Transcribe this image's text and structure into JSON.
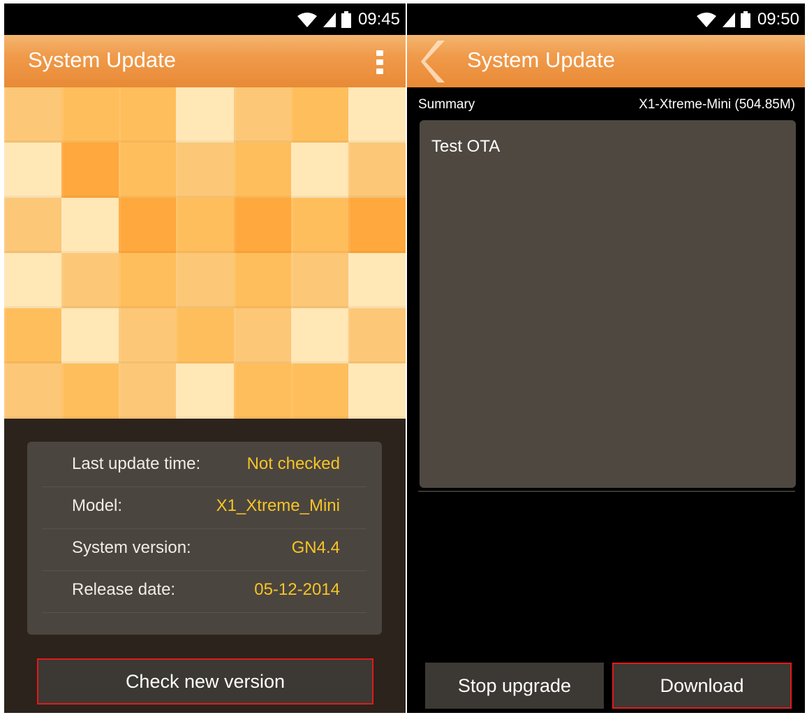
{
  "left": {
    "status": {
      "time": "09:45"
    },
    "title": "System Update",
    "info": [
      {
        "label": "Last update time:",
        "value": "Not checked"
      },
      {
        "label": "Model:",
        "value": "X1_Xtreme_Mini"
      },
      {
        "label": "System version:",
        "value": "GN4.4"
      },
      {
        "label": "Release date:",
        "value": "05-12-2014"
      }
    ],
    "check_button": "Check new version"
  },
  "right": {
    "status": {
      "time": "09:50"
    },
    "title": "System Update",
    "summary_label": "Summary",
    "summary_value": "X1-Xtreme-Mini (504.85M)",
    "notes": "Test OTA",
    "stop_button": "Stop upgrade",
    "download_button": "Download"
  },
  "colors": {
    "accent_orange": "#f09a4a",
    "value_yellow": "#f6c427",
    "highlight_red": "#e11b1b",
    "mosaic": [
      "#ffd38a",
      "#ffbe5c",
      "#ffa83d",
      "#ffe7b6",
      "#fcc777",
      "#fdb24b"
    ]
  },
  "icons": {
    "menu": "overflow-menu-icon",
    "back": "back-chevron-icon",
    "wifi": "wifi-icon",
    "signal": "signal-icon",
    "battery": "battery-icon"
  }
}
